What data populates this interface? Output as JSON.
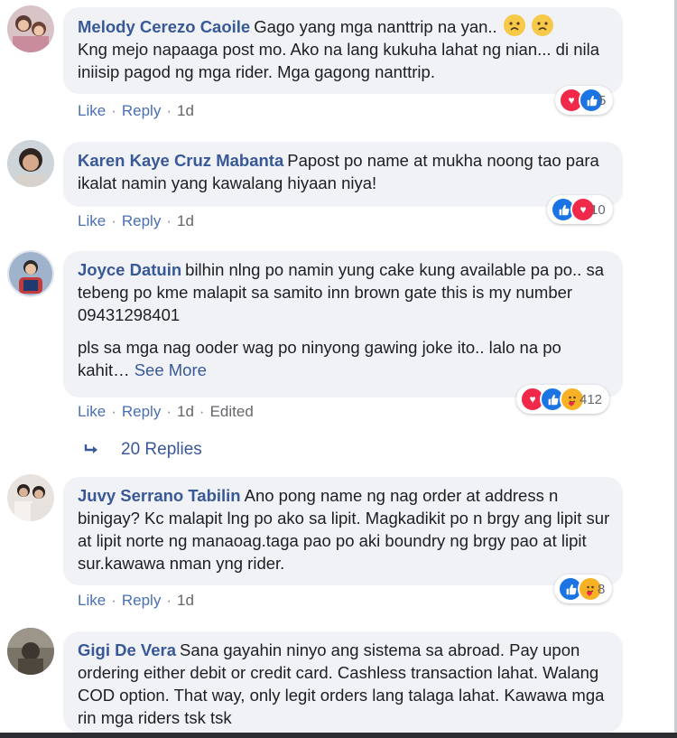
{
  "comments": [
    {
      "author": "Melody Cerezo Caoile",
      "text": "Gago yang mga nanttrip na yan..",
      "text2": "Kng mejo napaaga post mo. Ako na lang kukuha lahat ng nian... di nila iniisip pagod ng mga rider. Mga gagong nanttrip.",
      "like": "Like",
      "reply": "Reply",
      "time": "1d",
      "reaction_count": "5",
      "reactions": [
        "heart-icon",
        "like-icon"
      ]
    },
    {
      "author": "Karen Kaye Cruz Mabanta",
      "text": "Papost po name at mukha noong tao para ikalat namin yang kawalang hiyaan niya!",
      "like": "Like",
      "reply": "Reply",
      "time": "1d",
      "reaction_count": "10",
      "reactions": [
        "like-icon",
        "heart-icon"
      ]
    },
    {
      "author": "Joyce Datuin",
      "text": "bilhin nlng po namin yung cake kung available pa po.. sa tebeng po kme malapit sa samito inn brown gate this is my number 09431298401",
      "text2": "pls sa mga nag ooder wag po ninyong gawing joke ito.. lalo na po kahit…",
      "see_more": "See More",
      "like": "Like",
      "reply": "Reply",
      "time": "1d",
      "edited": "Edited",
      "reaction_count": "412",
      "reactions": [
        "heart-icon",
        "like-icon",
        "care-icon"
      ]
    },
    {
      "author": "Juvy Serrano Tabilin",
      "text": "Ano pong name ng nag order at address n binigay? Kc malapit lng po ako sa lipit. Magkadikit po n brgy ang lipit sur at lipit norte ng manaoag.taga pao po aki boundry ng brgy pao at lipit sur.kawawa nman yng rider.",
      "like": "Like",
      "reply": "Reply",
      "time": "1d",
      "reaction_count": "8",
      "reactions": [
        "like-icon",
        "care-icon"
      ]
    },
    {
      "author": "Gigi De Vera",
      "text": "Sana gayahin ninyo ang sistema sa abroad. Pay upon ordering either debit or credit card. Cashless transaction lahat. Walang COD option. That way, only legit orders lang talaga lahat. Kawawa mga rin mga riders tsk tsk"
    }
  ],
  "replies_label": "20 Replies",
  "colors": {
    "author": "#385898",
    "bubble": "#f0f2f5",
    "like_blue": "#1b74e4",
    "love_red": "#f02849"
  }
}
